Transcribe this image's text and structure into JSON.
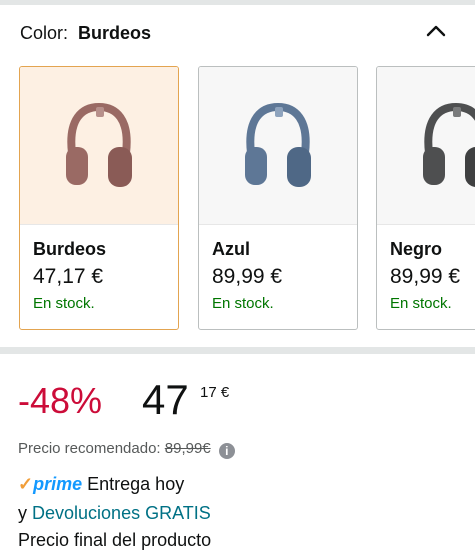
{
  "selector": {
    "label": "Color:",
    "value": "Burdeos",
    "collapse_icon": "chevron-up-icon"
  },
  "variants": [
    {
      "name": "Burdeos",
      "price": "47,17 €",
      "stock": "En stock.",
      "selected": true,
      "color": "#9a6a64"
    },
    {
      "name": "Azul",
      "price": "89,99 €",
      "stock": "En stock.",
      "selected": false,
      "color": "#5e7796"
    },
    {
      "name": "Negro",
      "price": "89,99 €",
      "stock": "En stock.",
      "selected": false,
      "color": "#4e4f50"
    }
  ],
  "pricing": {
    "discount": "-48%",
    "whole": "47",
    "cents": "17 €",
    "recommended_label": "Precio recomendado:",
    "recommended_value": "89,99€",
    "info_icon": "info-icon"
  },
  "delivery": {
    "prime_check": "✓",
    "prime_label": "prime",
    "delivery_text": "Entrega hoy",
    "returns_prefix": "y",
    "returns_link": "Devoluciones GRATIS",
    "final_text": "Precio final del producto"
  },
  "colors": {
    "discount": "#cc0c39",
    "in_stock": "#007600",
    "link": "#007185",
    "prime": "#1399ff",
    "selected_border": "#e3a450"
  }
}
